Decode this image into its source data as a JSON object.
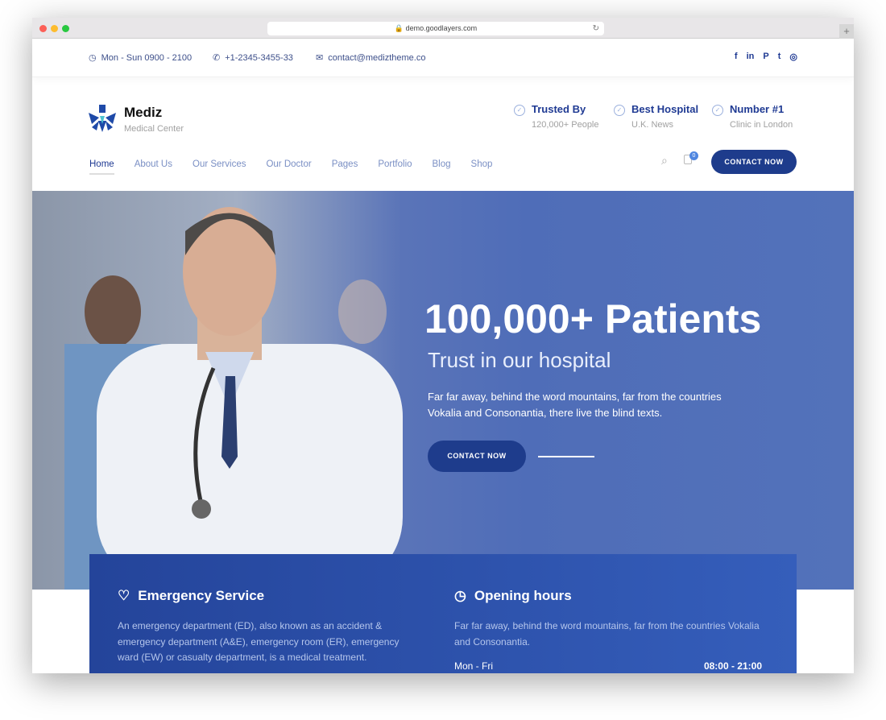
{
  "browser": {
    "url": "demo.goodlayers.com"
  },
  "topbar": {
    "hours": "Mon - Sun 0900 - 2100",
    "phone": "+1-2345-3455-33",
    "email": "contact@mediztheme.co",
    "social": [
      "f",
      "in",
      "P",
      "t",
      "ig"
    ]
  },
  "header": {
    "brand": "Mediz",
    "tagline": "Medical Center",
    "badges": [
      {
        "title": "Trusted By",
        "sub": "120,000+ People"
      },
      {
        "title": "Best Hospital",
        "sub": "U.K. News"
      },
      {
        "title": "Number #1",
        "sub": "Clinic in London"
      }
    ]
  },
  "nav": {
    "items": [
      "Home",
      "About Us",
      "Our Services",
      "Our Doctor",
      "Pages",
      "Portfolio",
      "Blog",
      "Shop"
    ],
    "cart_count": "0",
    "cta": "CONTACT NOW"
  },
  "hero": {
    "title": "100,000+ Patients",
    "subtitle": "Trust in our hospital",
    "text": "Far far away, behind the word mountains, far from the countries Vokalia and Consonantia, there live the blind texts.",
    "cta": "CONTACT NOW"
  },
  "info": {
    "emergency": {
      "title": "Emergency Service",
      "text": "An emergency department (ED), also known as an accident & emergency department (A&E), emergency room (ER), emergency ward (EW) or casualty department, is a medical treatment."
    },
    "hours": {
      "title": "Opening hours",
      "text": "Far far away, behind the word mountains, far from the countries Vokalia and Consonantia.",
      "day": "Mon - Fri",
      "time": "08:00 - 21:00"
    }
  },
  "colors": {
    "primary": "#1e3c8c",
    "accent": "#4f6db8"
  }
}
